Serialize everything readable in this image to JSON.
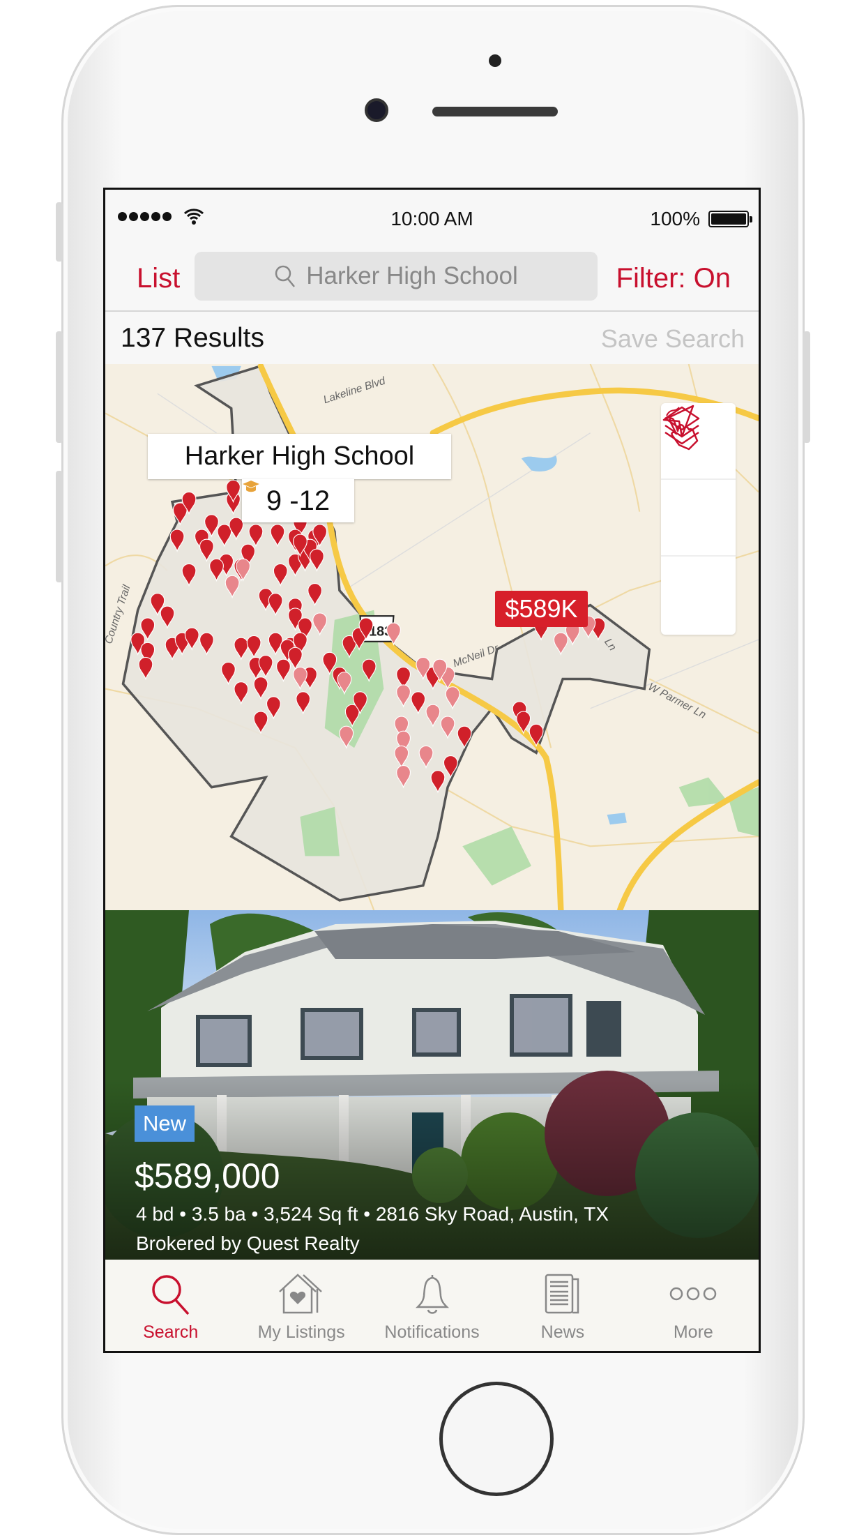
{
  "status_bar": {
    "time": "10:00 AM",
    "battery": "100%",
    "icons": [
      "signal-dots-icon",
      "wifi-icon",
      "battery-icon"
    ]
  },
  "nav": {
    "list_label": "List",
    "search_value": "Harker High School",
    "filter_label": "Filter: On"
  },
  "results": {
    "count_label": "137 Results",
    "save_label": "Save Search"
  },
  "map": {
    "roads": {
      "lakeline": "Lakeline Blvd",
      "country": "Country Trail",
      "mcneil": "McNeil Dr",
      "parmer": "W Parmer Ln",
      "route": "183",
      "ln": "Ln"
    },
    "school": {
      "name": "Harker High School",
      "grades": "9 -12",
      "icon": "graduation-cap-icon"
    },
    "price_tag": "$589K",
    "buttons": [
      "location-arrow-icon",
      "draw-hand-icon",
      "layers-icon"
    ],
    "colors": {
      "pin": "#d0202a",
      "pin_viewed": "#e8868b",
      "highway": "#f7c948",
      "district": "#e8e4de"
    }
  },
  "listing": {
    "badge": "New",
    "price": "$589,000",
    "details": "4 bd • 3.5 ba • 3,524 Sq ft • 2816 Sky Road, Austin, TX",
    "broker": "Brokered by Quest Realty"
  },
  "tabs": [
    {
      "label": "Search",
      "icon": "search-icon",
      "active": true
    },
    {
      "label": "My Listings",
      "icon": "house-heart-icon"
    },
    {
      "label": "Notifications",
      "icon": "bell-icon"
    },
    {
      "label": "News",
      "icon": "newspaper-icon"
    },
    {
      "label": "More",
      "icon": "more-dots-icon"
    }
  ],
  "accent": "#c8102e"
}
